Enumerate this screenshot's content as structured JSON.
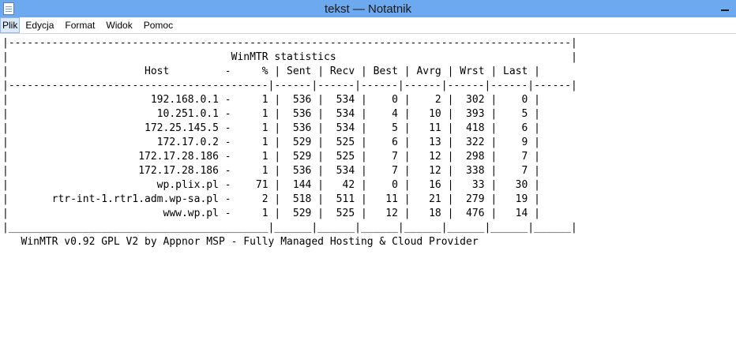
{
  "window": {
    "title": "tekst — Notatnik",
    "icon": "notepad-icon",
    "accent_color": "#6ca9ef"
  },
  "menu": [
    {
      "label": "Plik",
      "active": true
    },
    {
      "label": "Edycja"
    },
    {
      "label": "Format"
    },
    {
      "label": "Widok"
    },
    {
      "label": "Pomoc"
    }
  ],
  "report": {
    "title": "WinMTR statistics",
    "columns": [
      "Host",
      "-",
      "%",
      "Sent",
      "Recv",
      "Best",
      "Avrg",
      "Wrst",
      "Last"
    ],
    "rows": [
      [
        "192.168.0.1",
        "-",
        "1",
        "536",
        "534",
        "0",
        "2",
        "302",
        "0"
      ],
      [
        "10.251.0.1",
        "-",
        "1",
        "536",
        "534",
        "4",
        "10",
        "393",
        "5"
      ],
      [
        "172.25.145.5",
        "-",
        "1",
        "536",
        "534",
        "5",
        "11",
        "418",
        "6"
      ],
      [
        "172.17.0.2",
        "-",
        "1",
        "529",
        "525",
        "6",
        "13",
        "322",
        "9"
      ],
      [
        "172.17.28.186",
        "-",
        "1",
        "529",
        "525",
        "7",
        "12",
        "298",
        "7"
      ],
      [
        "172.17.28.186",
        "-",
        "1",
        "536",
        "534",
        "7",
        "12",
        "338",
        "7"
      ],
      [
        "wp.plix.pl",
        "-",
        "71",
        "144",
        "42",
        "0",
        "16",
        "33",
        "30"
      ],
      [
        "rtr-int-1.rtr1.adm.wp-sa.pl",
        "-",
        "2",
        "518",
        "511",
        "11",
        "21",
        "279",
        "19"
      ],
      [
        "www.wp.pl",
        "-",
        "1",
        "529",
        "525",
        "12",
        "18",
        "476",
        "14"
      ]
    ],
    "footer": "WinMTR v0.92 GPL V2 by Appnor MSP - Fully Managed Hosting & Cloud Provider"
  }
}
